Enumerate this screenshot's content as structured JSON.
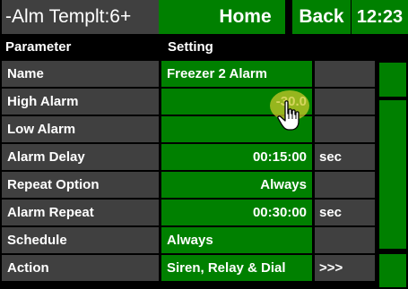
{
  "header": {
    "title": "-Alm Templt:6+",
    "home_label": "Home",
    "back_label": "Back",
    "time": "12:23"
  },
  "columns": {
    "parameter": "Parameter",
    "setting": "Setting"
  },
  "rows": [
    {
      "param": "Name",
      "value": "Freezer 2 Alarm",
      "align": "left",
      "unit": ""
    },
    {
      "param": "High Alarm",
      "value": "-30.0",
      "align": "right",
      "unit": ""
    },
    {
      "param": "Low Alarm",
      "value": "",
      "align": "right",
      "unit": ""
    },
    {
      "param": "Alarm Delay",
      "value": "00:15:00",
      "align": "right",
      "unit": "sec"
    },
    {
      "param": "Repeat Option",
      "value": "Always",
      "align": "right",
      "unit": ""
    },
    {
      "param": "Alarm Repeat",
      "value": "00:30:00",
      "align": "right",
      "unit": "sec"
    },
    {
      "param": "Schedule",
      "value": "Always",
      "align": "left",
      "unit": ""
    },
    {
      "param": "Action",
      "value": "Siren, Relay & Dial",
      "align": "left",
      "unit": ">>>"
    }
  ],
  "colors": {
    "green": "#008000",
    "gray": "#404040",
    "background": "#000000"
  },
  "icons": [
    "hand-pointer-icon"
  ]
}
